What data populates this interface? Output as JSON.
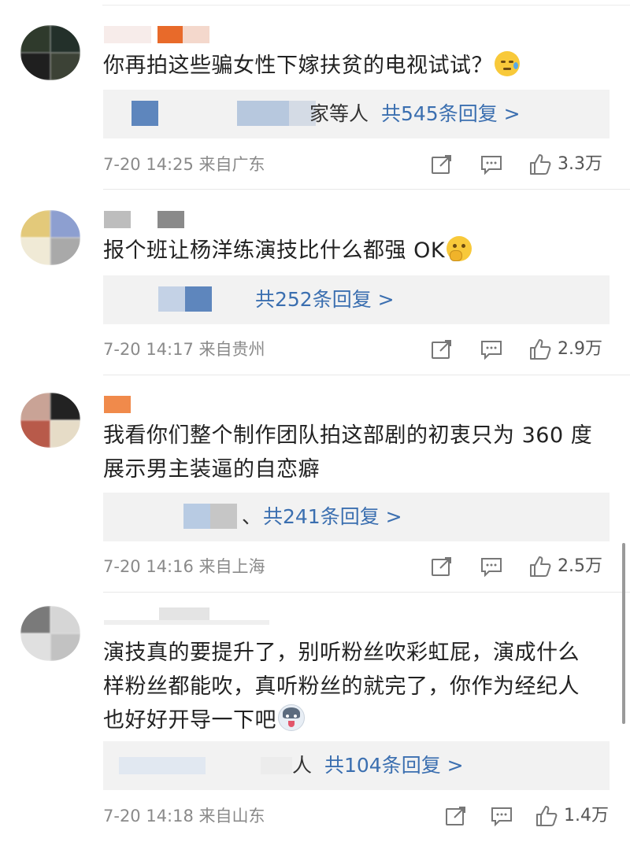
{
  "comments": [
    {
      "text": "你再拍这些骗女性下嫁扶贫的电视试试？",
      "emoji": "cold-sweat-emoji",
      "reply_prefix": "家等人",
      "reply_link": "共545条回复 >",
      "time": "7-20 14:25 来自广东",
      "likes": "3.3万"
    },
    {
      "text": "报个班让杨洋练演技比什么都强 OK",
      "emoji": "thinking-emoji",
      "reply_prefix": "",
      "reply_link": "共252条回复 >",
      "time": "7-20 14:17 来自贵州",
      "likes": "2.9万"
    },
    {
      "text_line1": "我看你们整个制作团队拍这部剧的初衷只为 360 度",
      "text_line2": "展示男主装逼的自恋癖",
      "reply_prefix": "、",
      "reply_link": "共241条回复 >",
      "time": "7-20 14:16 来自上海",
      "likes": "2.5万"
    },
    {
      "text_line1": "演技真的要提升了，别听粉丝吹彩虹屁，演成什么",
      "text_line2": "样粉丝都能吹，真听粉丝的就完了，你作为经纪人",
      "text_line3": "也好好开导一下吧",
      "emoji": "husky-emoji",
      "reply_prefix": "人",
      "reply_link": "共104条回复 >",
      "time": "7-20 14:18 来自山东",
      "likes": "1.4万"
    }
  ],
  "icons": {
    "share": "share-icon",
    "comment": "comment-icon",
    "like": "thumbs-up-icon"
  },
  "colors": {
    "link": "#3b6fb0",
    "meta": "#8a8a8a",
    "reply_bg": "#f2f2f2"
  }
}
